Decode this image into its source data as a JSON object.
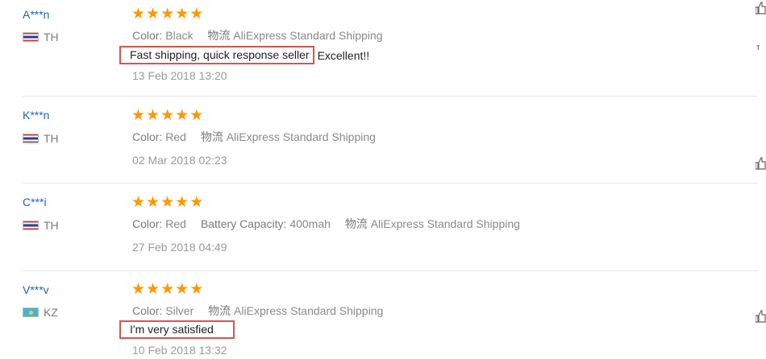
{
  "reviews": [
    {
      "user": "A***n",
      "country": "TH",
      "stars": 5,
      "color_label": "Color:",
      "color_value": "Black",
      "shipping_label": "物流",
      "shipping_value": "AliExpress Standard Shipping",
      "feedback": "Fast shipping, quick response seller",
      "feedback_extra": "Excellent!!",
      "date": "13 Feb 2018 13:20"
    },
    {
      "user": "K***n",
      "country": "TH",
      "stars": 5,
      "color_label": "Color:",
      "color_value": "Red",
      "shipping_label": "物流",
      "shipping_value": "AliExpress Standard Shipping",
      "date": "02 Mar 2018 02:23"
    },
    {
      "user": "C***i",
      "country": "TH",
      "stars": 5,
      "color_label": "Color:",
      "color_value": "Red",
      "battery_label": "Battery Capacity:",
      "battery_value": "400mah",
      "shipping_label": "物流",
      "shipping_value": "AliExpress Standard Shipping",
      "date": "27 Feb 2018 04:49"
    },
    {
      "user": "V***v",
      "country": "KZ",
      "stars": 5,
      "color_label": "Color:",
      "color_value": "Silver",
      "shipping_label": "物流",
      "shipping_value": "AliExpress Standard Shipping",
      "feedback": "I'm very satisfied",
      "date": "10 Feb 2018 13:32"
    }
  ],
  "side_letter": "т",
  "star_color": "#ff9800",
  "username_color": "#1a63c8",
  "highlight_color": "#d9534f"
}
